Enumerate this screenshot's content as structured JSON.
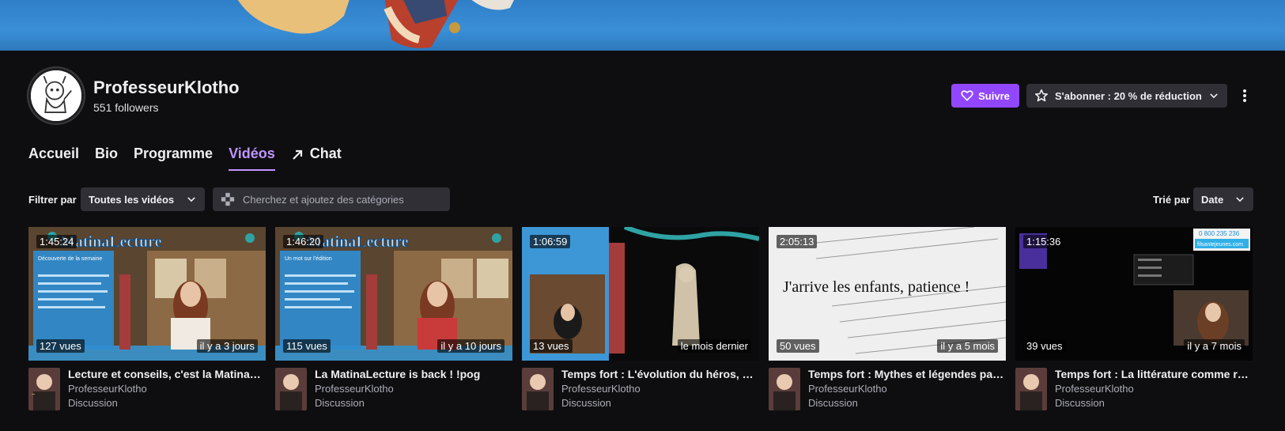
{
  "channel": {
    "name": "ProfesseurKlotho",
    "followers": "551 followers"
  },
  "actions": {
    "follow_label": "Suivre",
    "subscribe_label": "S'abonner : 20 % de réduction"
  },
  "tabs": [
    {
      "label": "Accueil",
      "active": false
    },
    {
      "label": "Bio",
      "active": false
    },
    {
      "label": "Programme",
      "active": false
    },
    {
      "label": "Vidéos",
      "active": true
    },
    {
      "label": "Chat",
      "active": false
    }
  ],
  "filters": {
    "filter_label": "Filtrer par",
    "filter_value": "Toutes les vidéos",
    "search_placeholder": "Cherchez et ajoutez des catégories",
    "sort_label": "Trié par",
    "sort_value": "Date"
  },
  "videos": [
    {
      "duration": "1:45:24",
      "views": "127 vues",
      "age": "il y a 3 jours",
      "title": "Lecture et conseils, c'est la MatinaLecture",
      "channel": "ProfesseurKlotho",
      "category": "Discussion",
      "thumb_text": "MatinaLecture",
      "panel_title": "Découverte de la semaine"
    },
    {
      "duration": "1:46:20",
      "views": "115 vues",
      "age": "il y a 10 jours",
      "title": "La MatinaLecture is back ! !pog",
      "channel": "ProfesseurKlotho",
      "category": "Discussion",
      "thumb_text": "MatinaLecture",
      "panel_title": "Un mot sur l'édition"
    },
    {
      "duration": "1:06:59",
      "views": "13 vues",
      "age": "le mois dernier",
      "title": "Temps fort : L'évolution du héros, de l'Antiquité à nos jours",
      "channel": "ProfesseurKlotho",
      "category": "Discussion"
    },
    {
      "duration": "2:05:13",
      "views": "50 vues",
      "age": "il y a 5 mois",
      "title": "Temps fort : Mythes et légendes pas si lointains",
      "channel": "ProfesseurKlotho",
      "category": "Discussion",
      "thumb_text": "J'arrive les enfants, patience !"
    },
    {
      "duration": "1:15:36",
      "views": "39 vues",
      "age": "il y a 7 mois",
      "title": "Temps fort : La littérature comme refuge",
      "channel": "ProfesseurKlotho",
      "category": "Discussion",
      "thumb_text": "filsantejeunes.com",
      "thumb_phone": "0 800 235 236"
    }
  ],
  "colors": {
    "accent": "#9147ff",
    "accent_text": "#bf94ff",
    "bg": "#0e0e10"
  }
}
